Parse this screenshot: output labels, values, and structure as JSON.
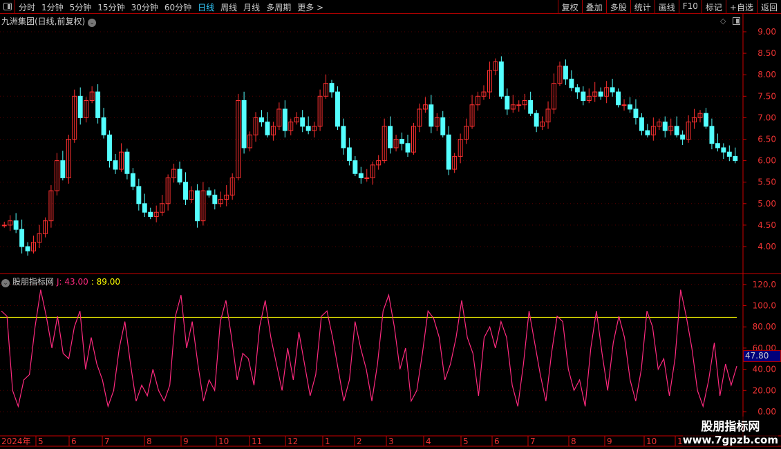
{
  "toolbar": {
    "periods": [
      "分时",
      "1分钟",
      "5分钟",
      "15分钟",
      "30分钟",
      "60分钟",
      "日线",
      "周线",
      "月线",
      "多周期",
      "更多 >"
    ],
    "active_index": 6,
    "buttons": [
      "复权",
      "叠加",
      "多股",
      "统计",
      "画线",
      "F10",
      "标记",
      "+自选",
      "返回"
    ]
  },
  "main": {
    "title": "九洲集团(日线,前复权)",
    "price_axis": [
      "9.00",
      "8.50",
      "8.00",
      "7.50",
      "7.00",
      "6.50",
      "6.00",
      "5.50",
      "5.00",
      "4.50",
      "4.00"
    ]
  },
  "indicator": {
    "name": "股朋指标网",
    "j_label": "J: 43.00",
    "line_label": ": 89.00",
    "line_value": 89,
    "current_tag": "47.80",
    "axis": [
      "120.0",
      "100.0",
      "80.00",
      "60.00",
      "40.00",
      "20.00",
      "0.00"
    ]
  },
  "time_axis": [
    "2024年",
    "5",
    "6",
    "7",
    "8",
    "9",
    "10",
    "11",
    "12",
    "1",
    "2",
    "3",
    "4",
    "5",
    "6",
    "7",
    "8",
    "9",
    "10",
    "1"
  ],
  "watermark": {
    "line1": "股朋指标网",
    "line2": "www.7gpzb.com"
  },
  "colors": {
    "up": "#ff3030",
    "down": "#54ffff",
    "j": "#ff2a7f",
    "level": "#ffff00",
    "axis": "#cc0000"
  },
  "chart_data": [
    {
      "type": "candlestick",
      "series": "九洲集团 close (approx)",
      "ylim": [
        3.6,
        9.1
      ],
      "closes": [
        4.5,
        4.6,
        4.4,
        4.0,
        3.9,
        4.1,
        4.3,
        4.6,
        5.3,
        6.0,
        5.6,
        6.5,
        7.5,
        7.0,
        7.4,
        7.6,
        7.0,
        6.6,
        6.0,
        5.8,
        6.2,
        5.7,
        5.4,
        5.0,
        4.8,
        4.7,
        4.8,
        5.0,
        5.6,
        5.8,
        5.5,
        5.1,
        5.3,
        4.6,
        5.3,
        5.2,
        5.0,
        5.1,
        5.2,
        5.6,
        7.4,
        6.3,
        6.6,
        7.0,
        6.9,
        6.6,
        6.8,
        7.2,
        6.7,
        6.9,
        7.0,
        6.8,
        6.7,
        6.8,
        7.5,
        7.8,
        7.6,
        6.8,
        6.3,
        6.0,
        5.7,
        5.6,
        5.6,
        5.9,
        6.0,
        6.8,
        6.3,
        6.5,
        6.4,
        6.2,
        6.8,
        7.2,
        7.3,
        6.8,
        7.0,
        6.6,
        5.8,
        6.1,
        6.5,
        6.8,
        7.3,
        7.5,
        7.6,
        8.1,
        8.3,
        7.5,
        7.2,
        7.3,
        7.3,
        7.4,
        7.1,
        6.8,
        6.9,
        7.2,
        7.8,
        8.2,
        7.9,
        7.7,
        7.6,
        7.4,
        7.5,
        7.6,
        7.5,
        7.7,
        7.6,
        7.3,
        7.3,
        7.2,
        7.0,
        6.7,
        6.6,
        6.8,
        6.9,
        6.7,
        6.8,
        6.6,
        6.5,
        6.9,
        7.0,
        7.1,
        6.8,
        6.4,
        6.3,
        6.2,
        6.1,
        6.0
      ]
    },
    {
      "type": "line",
      "series": "J",
      "ylim": [
        0,
        120
      ],
      "level": 89,
      "values": [
        95,
        90,
        20,
        5,
        30,
        35,
        80,
        115,
        90,
        60,
        90,
        55,
        50,
        80,
        95,
        40,
        70,
        45,
        30,
        5,
        20,
        60,
        85,
        45,
        10,
        25,
        15,
        40,
        20,
        10,
        25,
        90,
        110,
        60,
        85,
        45,
        10,
        30,
        20,
        85,
        105,
        70,
        30,
        55,
        50,
        25,
        80,
        105,
        70,
        45,
        20,
        60,
        30,
        75,
        45,
        15,
        35,
        90,
        95,
        70,
        40,
        10,
        30,
        85,
        60,
        40,
        10,
        45,
        95,
        110,
        80,
        40,
        60,
        10,
        20,
        55,
        95,
        88,
        70,
        30,
        45,
        70,
        105,
        70,
        55,
        15,
        70,
        80,
        60,
        85,
        70,
        25,
        5,
        45,
        95,
        65,
        35,
        10,
        55,
        90,
        85,
        40,
        20,
        30,
        5,
        60,
        95,
        55,
        20,
        65,
        90,
        70,
        30,
        10,
        40,
        95,
        80,
        40,
        50,
        15,
        50,
        115,
        90,
        60,
        20,
        5,
        30,
        65,
        15,
        45,
        25,
        43
      ]
    }
  ]
}
